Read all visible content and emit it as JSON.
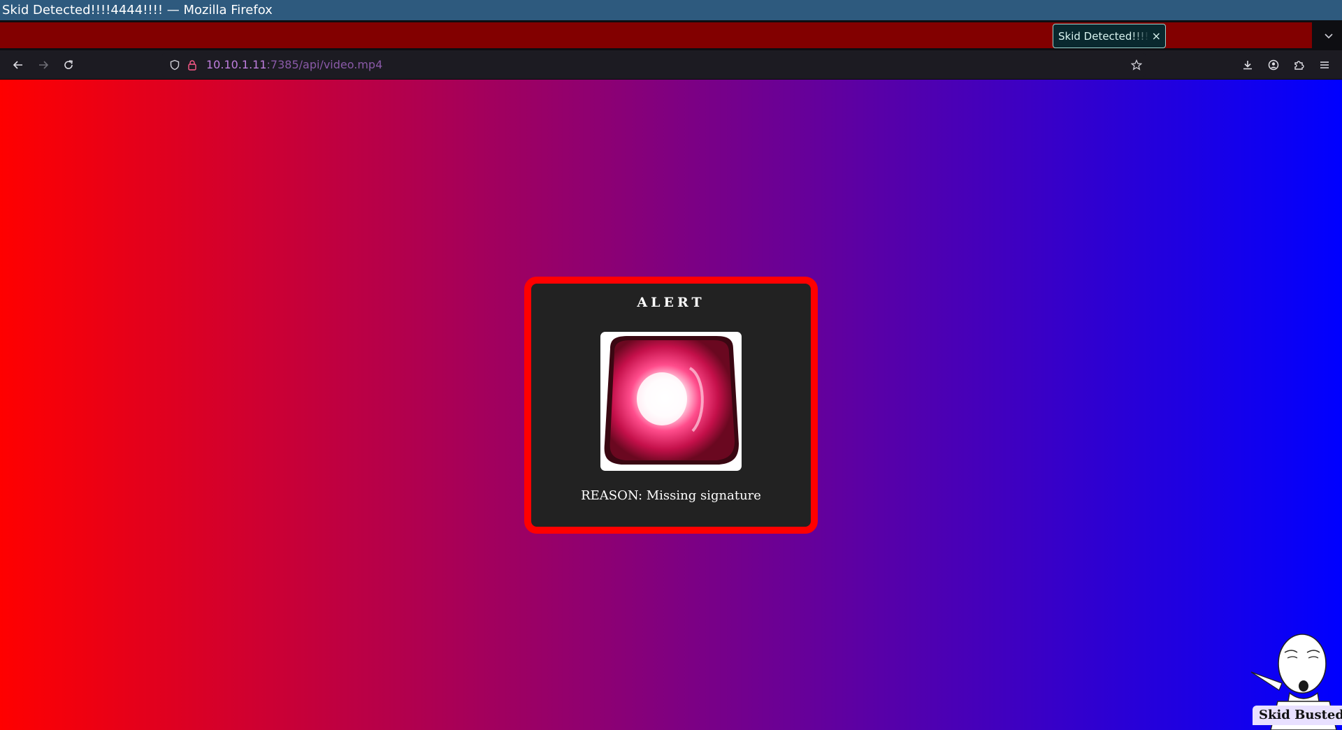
{
  "window": {
    "title": "Skid Detected!!!!4444!!!! — Mozilla Firefox"
  },
  "tabs": [
    {
      "label": "Skid Detected!!!!4444!!!!",
      "close_glyph": "×",
      "active": true
    }
  ],
  "toolbar": {
    "url_host": "10.10.1.11",
    "url_path": ":7385/api/video.mp4"
  },
  "page": {
    "alert_title": "ALERT",
    "alert_reason": "REASON: Missing signature",
    "corner_caption": "Skid Busted"
  },
  "colors": {
    "gradient_left": "#ff0000",
    "gradient_mid": "#800080",
    "gradient_right": "#0000ff",
    "alert_border": "#ff0000",
    "alert_background": "#222222",
    "tab_strip": "#820000",
    "titlebar": "#2e5a7e"
  },
  "icons": {
    "back": "back-arrow-icon",
    "forward": "forward-arrow-icon",
    "reload": "reload-icon",
    "tracking_protection": "shield-icon",
    "connection": "lock-icon",
    "bookmark": "star-icon",
    "downloads": "download-icon",
    "account": "account-icon",
    "extensions": "puzzle-icon",
    "menu": "hamburger-menu-icon",
    "tab_list": "chevron-down-icon",
    "alert_image": "siren-light-icon"
  }
}
